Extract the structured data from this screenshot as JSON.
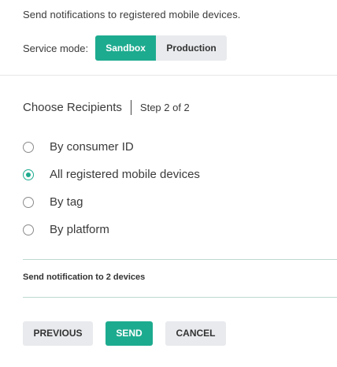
{
  "intro_text": "Send notifications to registered mobile devices.",
  "service_mode": {
    "label": "Service mode:",
    "options": [
      "Sandbox",
      "Production"
    ],
    "selected": "Sandbox"
  },
  "recipients": {
    "heading": "Choose Recipients",
    "step": "Step 2 of 2",
    "options": [
      {
        "label": "By consumer ID",
        "checked": false
      },
      {
        "label": "All registered mobile devices",
        "checked": true
      },
      {
        "label": "By tag",
        "checked": false
      },
      {
        "label": "By platform",
        "checked": false
      }
    ]
  },
  "summary_text": "Send notification to 2 devices",
  "buttons": {
    "previous": "PREVIOUS",
    "send": "SEND",
    "cancel": "CANCEL"
  },
  "colors": {
    "accent": "#1dab8f",
    "secondary_button": "#e8eaed"
  },
  "icons": {
    "radio_unchecked": "radio-unchecked-icon",
    "radio_checked": "radio-checked-icon"
  }
}
